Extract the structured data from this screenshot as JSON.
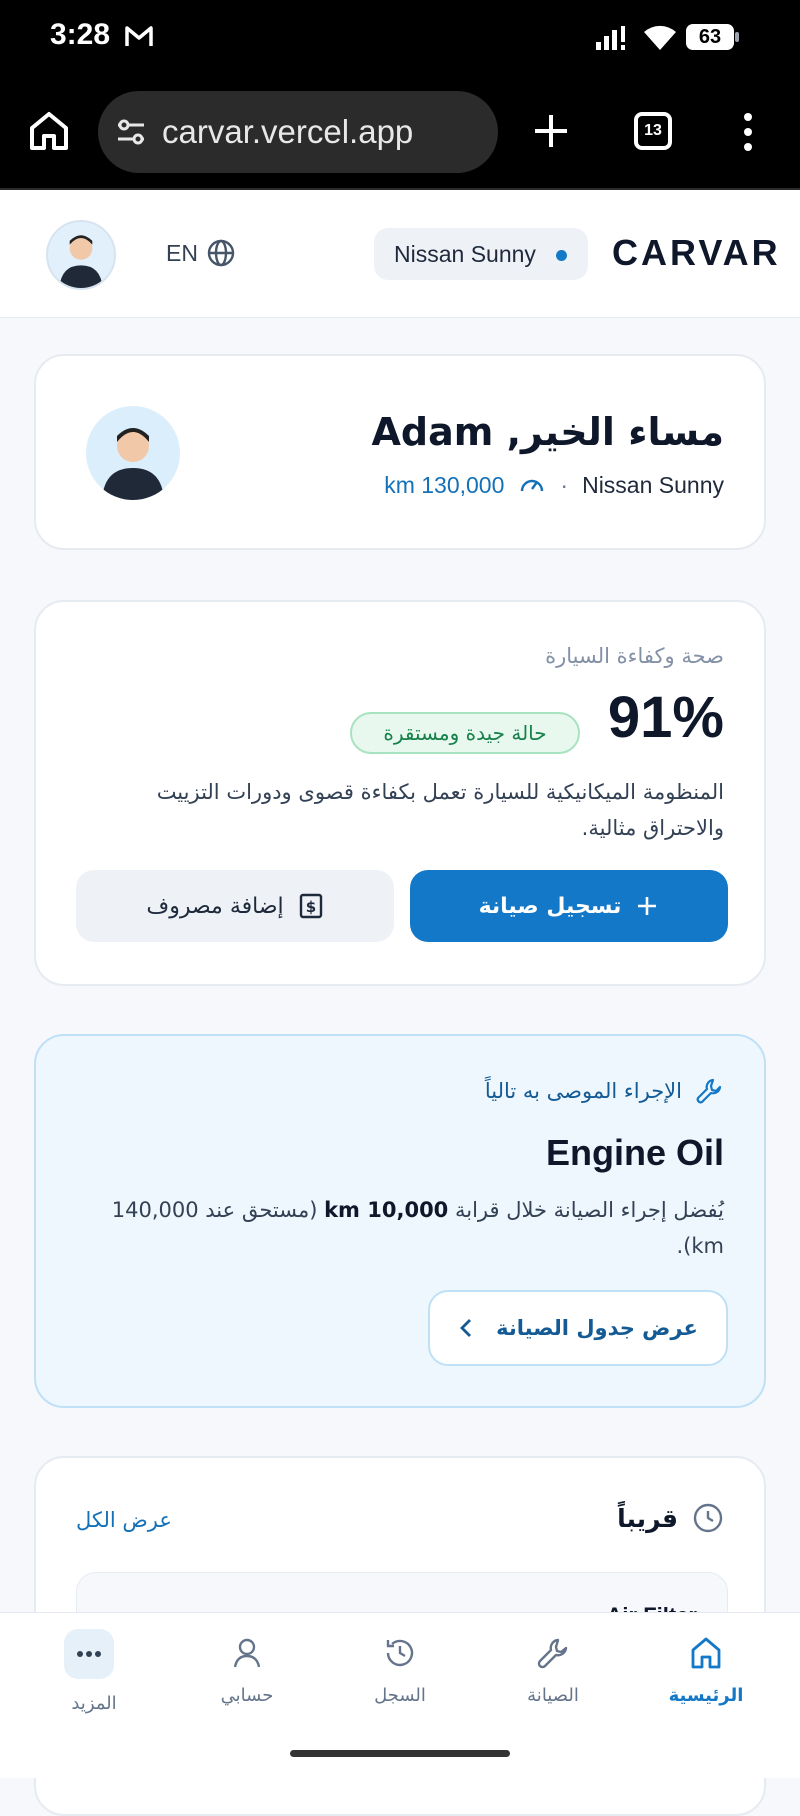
{
  "status_bar": {
    "time": "3:28",
    "battery": "63"
  },
  "browser": {
    "url": "carvar.vercel.app",
    "tab_count": "13"
  },
  "header": {
    "lang_label": "EN",
    "car_name": "Nissan Sunny",
    "brand": "CARVAR"
  },
  "greeting": {
    "title": "مساء الخير, Adam",
    "car": "Nissan Sunny",
    "separator": "·",
    "mileage": "km 130,000"
  },
  "health": {
    "label": "صحة وكفاءة السيارة",
    "percent": "91%",
    "badge": "حالة جيدة ومستقرة",
    "description": "المنظومة الميكانيكية للسيارة تعمل بكفاءة قصوى ودورات التزييت والاحتراق مثالية.",
    "primary_button": "تسجيل صيانة",
    "secondary_button": "إضافة مصروف"
  },
  "recommendation": {
    "heading": "الإجراء الموصى به تالياً",
    "title": "Engine Oil",
    "desc_before": "يُفضل إجراء الصيانة خلال قرابة",
    "desc_bold": "km 10,000",
    "desc_after": "(مستحق عند 140,000 km).",
    "button": "عرض جدول الصيانة"
  },
  "upcoming": {
    "heading": "قريباً",
    "view_all": "عرض الكل",
    "first_item": "Air Filter"
  },
  "nav": {
    "home": "الرئيسية",
    "maintenance": "الصيانة",
    "history": "السجل",
    "account": "حسابي",
    "more": "المزيد"
  },
  "colors": {
    "accent": "#1478c8",
    "good": "#17814a",
    "bg": "#f6f8fb"
  }
}
